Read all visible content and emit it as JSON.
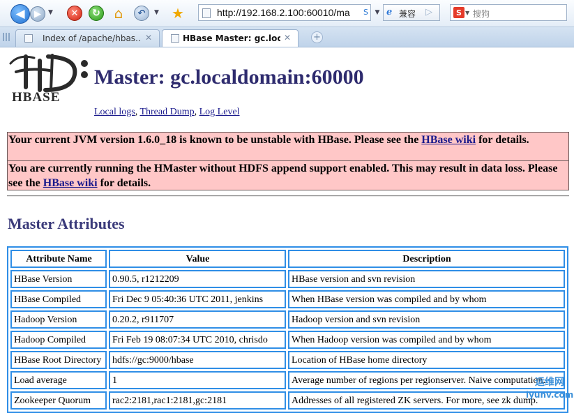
{
  "browser": {
    "address_url": "http://192.168.2.100:60010/ma",
    "compat_label": "兼容",
    "search_placeholder": "搜狗",
    "tabs": [
      {
        "label": "Index of /apache/hbas…",
        "active": false
      },
      {
        "label": "HBase Master: gc.loca…",
        "active": true
      }
    ]
  },
  "logo": {
    "text": "HBASE"
  },
  "page": {
    "title": "Master: gc.localdomain:60000",
    "links": [
      "Local logs",
      "Thread Dump",
      "Log Level"
    ],
    "warnings": [
      {
        "before": "Your current JVM version 1.6.0_18 is known to be unstable with HBase. Please see the ",
        "link": "HBase wiki",
        "after": " for details."
      },
      {
        "before": "You are currently running the HMaster without HDFS append support enabled. This may result in data loss. Please see the ",
        "link": "HBase wiki",
        "after": " for details."
      }
    ],
    "section_title": "Master Attributes"
  },
  "table": {
    "headers": [
      "Attribute Name",
      "Value",
      "Description"
    ],
    "rows": [
      [
        "HBase Version",
        "0.90.5, r1212209",
        "HBase version and svn revision"
      ],
      [
        "HBase Compiled",
        "Fri Dec 9 05:40:36 UTC 2011, jenkins",
        "When HBase version was compiled and by whom"
      ],
      [
        "Hadoop Version",
        "0.20.2, r911707",
        "Hadoop version and svn revision"
      ],
      [
        "Hadoop Compiled",
        "Fri Feb 19 08:07:34 UTC 2010, chrisdo",
        "When Hadoop version was compiled and by whom"
      ],
      [
        "HBase Root Directory",
        "hdfs://gc:9000/hbase",
        "Location of HBase home directory"
      ],
      [
        "Load average",
        "1",
        "Average number of regions per regionserver. Naive computation."
      ],
      [
        "Zookeeper Quorum",
        "rac2:2181,rac1:2181,gc:2181",
        "Addresses of all registered ZK servers. For more, see zk dump."
      ]
    ]
  },
  "watermark": {
    "line1": "运维网",
    "line2": "iyunv.com"
  },
  "colors": {
    "accent": "#2f8ee6",
    "warning_bg": "#ffc7c7",
    "title": "#2e2b6e"
  }
}
